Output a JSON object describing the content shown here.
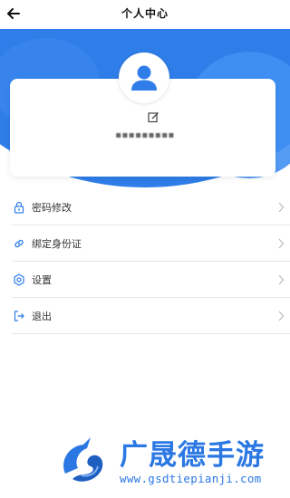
{
  "header": {
    "title": "个人中心"
  },
  "profile": {
    "username": "▪▪▪▪▪▪▪▪▪"
  },
  "menu": {
    "items": [
      {
        "label": "密码修改",
        "icon": "lock-icon"
      },
      {
        "label": "绑定身份证",
        "icon": "link-icon"
      },
      {
        "label": "设置",
        "icon": "gear-icon"
      },
      {
        "label": "退出",
        "icon": "logout-icon"
      }
    ]
  },
  "watermark": {
    "title": "广晟德手游",
    "url": "www.gsdtiepianji.com"
  },
  "colors": {
    "primary": "#2f7de8",
    "watermark": "#2b78e4"
  }
}
